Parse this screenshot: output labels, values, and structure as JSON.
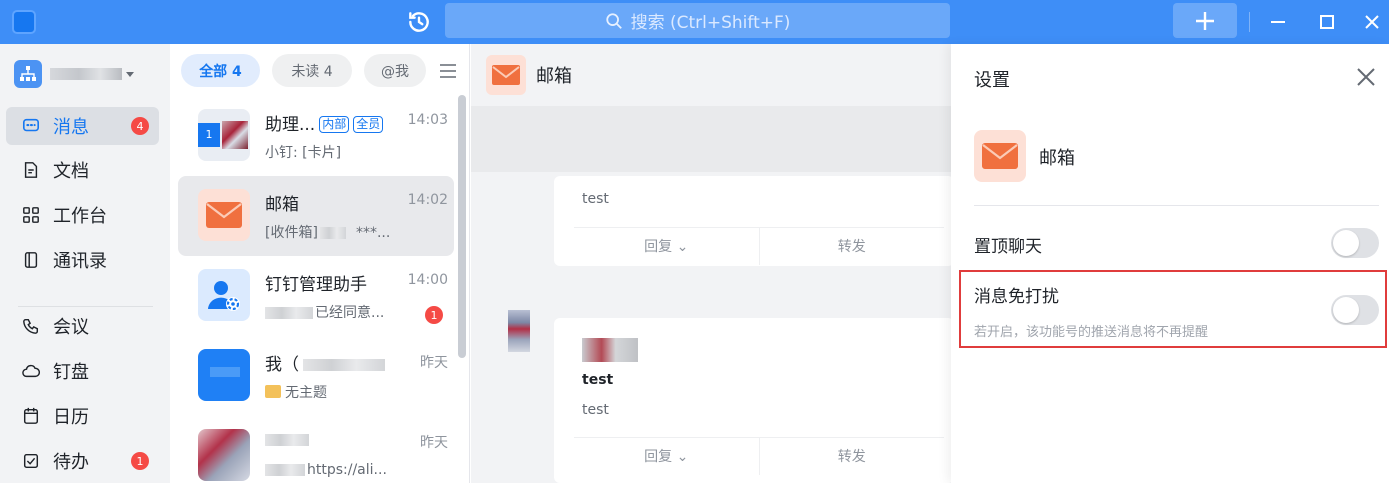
{
  "search": {
    "placeholder": "搜索 (Ctrl+Shift+F)"
  },
  "nav": {
    "items": [
      {
        "label": "消息",
        "badge": "4"
      },
      {
        "label": "文档"
      },
      {
        "label": "工作台"
      },
      {
        "label": "通讯录"
      },
      {
        "label": "会议"
      },
      {
        "label": "钉盘"
      },
      {
        "label": "日历"
      },
      {
        "label": "待办",
        "badge": "1"
      }
    ]
  },
  "filters": [
    {
      "label": "全部 4"
    },
    {
      "label": "未读 4"
    },
    {
      "label": "@我"
    }
  ],
  "chats": [
    {
      "name": "助理...",
      "tags": [
        "内部",
        "全员"
      ],
      "time": "14:03",
      "preview": "小钉: [卡片]"
    },
    {
      "name": "邮箱",
      "time": "14:02",
      "preview": "[收件箱]",
      "preview_tail": "***..."
    },
    {
      "name": "钉钉管理助手",
      "time": "14:00",
      "preview": "已经同意...",
      "badge": "1"
    },
    {
      "name": "我（",
      "time": "昨天",
      "preview": "无主题"
    },
    {
      "name": "",
      "time": "昨天",
      "preview": "https://ali..."
    }
  ],
  "chat": {
    "title": "邮箱",
    "messages": [
      {
        "subject": "",
        "body": "test",
        "actions": [
          "回复 ⌄",
          "转发"
        ]
      },
      {
        "subject": "test",
        "body": "test",
        "actions": [
          "回复 ⌄",
          "转发"
        ]
      }
    ]
  },
  "settings": {
    "title": "设置",
    "account_name": "邮箱",
    "pin_label": "置顶聊天",
    "pin_on": false,
    "dnd_label": "消息免打扰",
    "dnd_desc": "若开启，该功能号的推送消息将不再提醒",
    "dnd_on": false
  },
  "colors": {
    "titlebar": "#3e8ef7",
    "accent": "#1677f0",
    "badge": "#f54a45",
    "highlight": "#e03c3c"
  }
}
